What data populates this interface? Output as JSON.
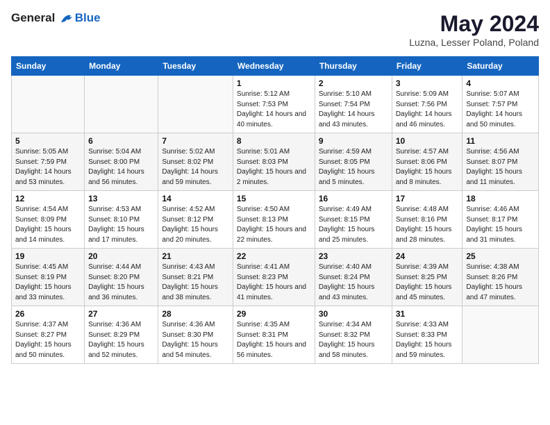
{
  "header": {
    "logo_general": "General",
    "logo_blue": "Blue",
    "title": "May 2024",
    "subtitle": "Luzna, Lesser Poland, Poland"
  },
  "days_of_week": [
    "Sunday",
    "Monday",
    "Tuesday",
    "Wednesday",
    "Thursday",
    "Friday",
    "Saturday"
  ],
  "weeks": [
    [
      {
        "day": "",
        "sunrise": "",
        "sunset": "",
        "daylight": ""
      },
      {
        "day": "",
        "sunrise": "",
        "sunset": "",
        "daylight": ""
      },
      {
        "day": "",
        "sunrise": "",
        "sunset": "",
        "daylight": ""
      },
      {
        "day": "1",
        "sunrise": "Sunrise: 5:12 AM",
        "sunset": "Sunset: 7:53 PM",
        "daylight": "Daylight: 14 hours and 40 minutes."
      },
      {
        "day": "2",
        "sunrise": "Sunrise: 5:10 AM",
        "sunset": "Sunset: 7:54 PM",
        "daylight": "Daylight: 14 hours and 43 minutes."
      },
      {
        "day": "3",
        "sunrise": "Sunrise: 5:09 AM",
        "sunset": "Sunset: 7:56 PM",
        "daylight": "Daylight: 14 hours and 46 minutes."
      },
      {
        "day": "4",
        "sunrise": "Sunrise: 5:07 AM",
        "sunset": "Sunset: 7:57 PM",
        "daylight": "Daylight: 14 hours and 50 minutes."
      }
    ],
    [
      {
        "day": "5",
        "sunrise": "Sunrise: 5:05 AM",
        "sunset": "Sunset: 7:59 PM",
        "daylight": "Daylight: 14 hours and 53 minutes."
      },
      {
        "day": "6",
        "sunrise": "Sunrise: 5:04 AM",
        "sunset": "Sunset: 8:00 PM",
        "daylight": "Daylight: 14 hours and 56 minutes."
      },
      {
        "day": "7",
        "sunrise": "Sunrise: 5:02 AM",
        "sunset": "Sunset: 8:02 PM",
        "daylight": "Daylight: 14 hours and 59 minutes."
      },
      {
        "day": "8",
        "sunrise": "Sunrise: 5:01 AM",
        "sunset": "Sunset: 8:03 PM",
        "daylight": "Daylight: 15 hours and 2 minutes."
      },
      {
        "day": "9",
        "sunrise": "Sunrise: 4:59 AM",
        "sunset": "Sunset: 8:05 PM",
        "daylight": "Daylight: 15 hours and 5 minutes."
      },
      {
        "day": "10",
        "sunrise": "Sunrise: 4:57 AM",
        "sunset": "Sunset: 8:06 PM",
        "daylight": "Daylight: 15 hours and 8 minutes."
      },
      {
        "day": "11",
        "sunrise": "Sunrise: 4:56 AM",
        "sunset": "Sunset: 8:07 PM",
        "daylight": "Daylight: 15 hours and 11 minutes."
      }
    ],
    [
      {
        "day": "12",
        "sunrise": "Sunrise: 4:54 AM",
        "sunset": "Sunset: 8:09 PM",
        "daylight": "Daylight: 15 hours and 14 minutes."
      },
      {
        "day": "13",
        "sunrise": "Sunrise: 4:53 AM",
        "sunset": "Sunset: 8:10 PM",
        "daylight": "Daylight: 15 hours and 17 minutes."
      },
      {
        "day": "14",
        "sunrise": "Sunrise: 4:52 AM",
        "sunset": "Sunset: 8:12 PM",
        "daylight": "Daylight: 15 hours and 20 minutes."
      },
      {
        "day": "15",
        "sunrise": "Sunrise: 4:50 AM",
        "sunset": "Sunset: 8:13 PM",
        "daylight": "Daylight: 15 hours and 22 minutes."
      },
      {
        "day": "16",
        "sunrise": "Sunrise: 4:49 AM",
        "sunset": "Sunset: 8:15 PM",
        "daylight": "Daylight: 15 hours and 25 minutes."
      },
      {
        "day": "17",
        "sunrise": "Sunrise: 4:48 AM",
        "sunset": "Sunset: 8:16 PM",
        "daylight": "Daylight: 15 hours and 28 minutes."
      },
      {
        "day": "18",
        "sunrise": "Sunrise: 4:46 AM",
        "sunset": "Sunset: 8:17 PM",
        "daylight": "Daylight: 15 hours and 31 minutes."
      }
    ],
    [
      {
        "day": "19",
        "sunrise": "Sunrise: 4:45 AM",
        "sunset": "Sunset: 8:19 PM",
        "daylight": "Daylight: 15 hours and 33 minutes."
      },
      {
        "day": "20",
        "sunrise": "Sunrise: 4:44 AM",
        "sunset": "Sunset: 8:20 PM",
        "daylight": "Daylight: 15 hours and 36 minutes."
      },
      {
        "day": "21",
        "sunrise": "Sunrise: 4:43 AM",
        "sunset": "Sunset: 8:21 PM",
        "daylight": "Daylight: 15 hours and 38 minutes."
      },
      {
        "day": "22",
        "sunrise": "Sunrise: 4:41 AM",
        "sunset": "Sunset: 8:23 PM",
        "daylight": "Daylight: 15 hours and 41 minutes."
      },
      {
        "day": "23",
        "sunrise": "Sunrise: 4:40 AM",
        "sunset": "Sunset: 8:24 PM",
        "daylight": "Daylight: 15 hours and 43 minutes."
      },
      {
        "day": "24",
        "sunrise": "Sunrise: 4:39 AM",
        "sunset": "Sunset: 8:25 PM",
        "daylight": "Daylight: 15 hours and 45 minutes."
      },
      {
        "day": "25",
        "sunrise": "Sunrise: 4:38 AM",
        "sunset": "Sunset: 8:26 PM",
        "daylight": "Daylight: 15 hours and 47 minutes."
      }
    ],
    [
      {
        "day": "26",
        "sunrise": "Sunrise: 4:37 AM",
        "sunset": "Sunset: 8:27 PM",
        "daylight": "Daylight: 15 hours and 50 minutes."
      },
      {
        "day": "27",
        "sunrise": "Sunrise: 4:36 AM",
        "sunset": "Sunset: 8:29 PM",
        "daylight": "Daylight: 15 hours and 52 minutes."
      },
      {
        "day": "28",
        "sunrise": "Sunrise: 4:36 AM",
        "sunset": "Sunset: 8:30 PM",
        "daylight": "Daylight: 15 hours and 54 minutes."
      },
      {
        "day": "29",
        "sunrise": "Sunrise: 4:35 AM",
        "sunset": "Sunset: 8:31 PM",
        "daylight": "Daylight: 15 hours and 56 minutes."
      },
      {
        "day": "30",
        "sunrise": "Sunrise: 4:34 AM",
        "sunset": "Sunset: 8:32 PM",
        "daylight": "Daylight: 15 hours and 58 minutes."
      },
      {
        "day": "31",
        "sunrise": "Sunrise: 4:33 AM",
        "sunset": "Sunset: 8:33 PM",
        "daylight": "Daylight: 15 hours and 59 minutes."
      },
      {
        "day": "",
        "sunrise": "",
        "sunset": "",
        "daylight": ""
      }
    ]
  ]
}
